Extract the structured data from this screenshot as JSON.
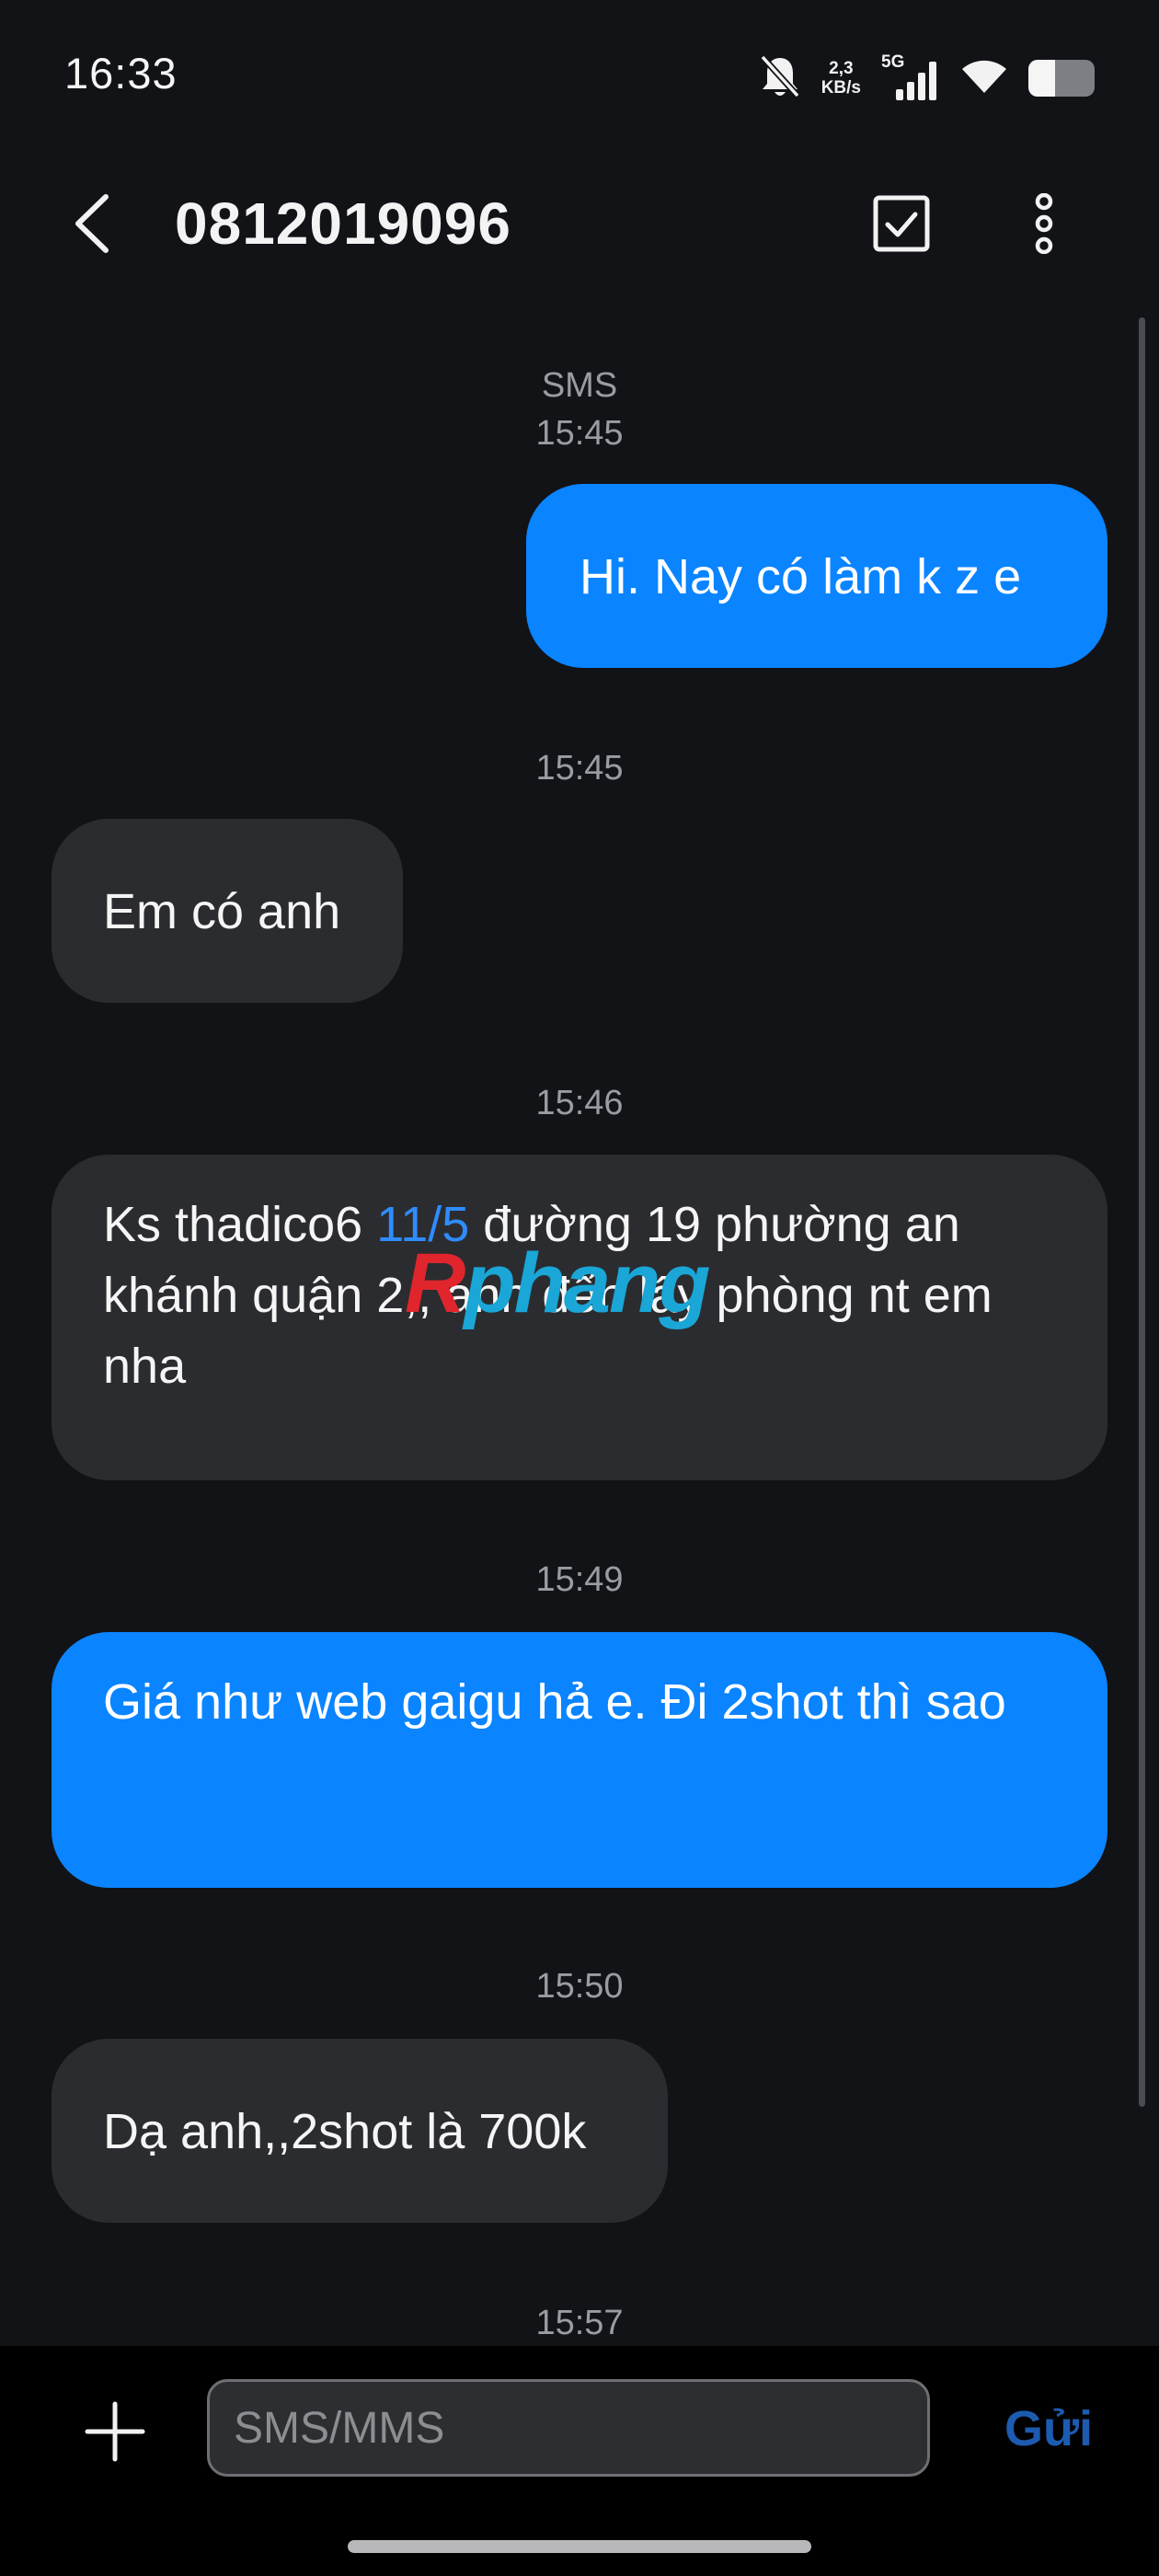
{
  "status_bar": {
    "time": "16:33",
    "net_speed_value": "2,3",
    "net_speed_unit": "KB/s",
    "network_type": "5G",
    "battery_level": 0.4,
    "icons": [
      "bell-off-icon",
      "signal-icon",
      "wifi-icon",
      "battery-icon"
    ]
  },
  "header": {
    "title": "0812019096",
    "icons": [
      "back-arrow-icon",
      "select-checkbox-icon",
      "more-vertical-icon"
    ]
  },
  "conversation": {
    "channel_label": "SMS",
    "messages": [
      {
        "time": "15:45",
        "direction": "outgoing",
        "text": "Hi. Nay có làm k z e"
      },
      {
        "time": "15:45",
        "direction": "incoming",
        "text": "Em có anh"
      },
      {
        "time": "15:46",
        "direction": "incoming",
        "text_before_link": "Ks thadico6 ",
        "link_text": "11/5",
        "text_after_link": " đường 19 phường an khánh quận 2,, anh đến lấy phòng nt em nha"
      },
      {
        "time": "15:49",
        "direction": "outgoing",
        "text": "Giá như web gaigu hả e. Đi 2shot thì sao"
      },
      {
        "time": "15:50",
        "direction": "incoming",
        "text": "Dạ anh,,2shot là 700k"
      },
      {
        "time": "15:57"
      }
    ]
  },
  "watermark": {
    "part1": "R",
    "part2": "phang"
  },
  "composer": {
    "placeholder": "SMS/MMS",
    "value": "",
    "send_label": "Gửi",
    "icons": [
      "plus-icon"
    ]
  },
  "colors": {
    "background": "#121316",
    "outgoing_bubble": "#0a84ff",
    "incoming_bubble": "#2b2c30",
    "link": "#2f8cff",
    "send_label": "#1c5bb0"
  }
}
